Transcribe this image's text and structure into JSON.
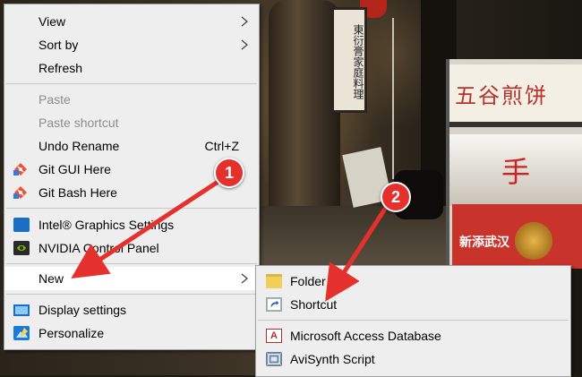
{
  "wallpaper": {
    "banner_text": "東衍膏家庭料理",
    "shop_sign_text": "五谷煎饼",
    "shop_glass_text": "手",
    "shop_menu_text": "新添武汉"
  },
  "main_menu": {
    "items": [
      {
        "label": "View",
        "has_submenu": true,
        "enabled": true
      },
      {
        "label": "Sort by",
        "has_submenu": true,
        "enabled": true
      },
      {
        "label": "Refresh",
        "enabled": true
      },
      {
        "label": "Paste",
        "enabled": false
      },
      {
        "label": "Paste shortcut",
        "enabled": false
      },
      {
        "label": "Undo Rename",
        "shortcut": "Ctrl+Z",
        "enabled": true
      },
      {
        "label": "Git GUI Here",
        "icon": "git-icon",
        "enabled": true
      },
      {
        "label": "Git Bash Here",
        "icon": "git-icon",
        "enabled": true
      },
      {
        "label": "Intel® Graphics Settings",
        "icon": "intel-graphics-icon",
        "enabled": true
      },
      {
        "label": "NVIDIA Control Panel",
        "icon": "nvidia-icon",
        "enabled": true
      },
      {
        "label": "New",
        "has_submenu": true,
        "highlighted": true,
        "enabled": true
      },
      {
        "label": "Display settings",
        "icon": "display-icon",
        "enabled": true
      },
      {
        "label": "Personalize",
        "icon": "personalize-icon",
        "enabled": true
      }
    ]
  },
  "sub_menu": {
    "items": [
      {
        "label": "Folder",
        "icon": "folder-icon"
      },
      {
        "label": "Shortcut",
        "icon": "shortcut-icon"
      },
      {
        "label": "Microsoft Access Database",
        "icon": "access-icon",
        "icon_text": "A"
      },
      {
        "label": "AviSynth Script",
        "icon": "avisynth-icon"
      }
    ]
  },
  "callouts": [
    {
      "number": "1",
      "color": "#e5312d"
    },
    {
      "number": "2",
      "color": "#e5312d"
    }
  ]
}
